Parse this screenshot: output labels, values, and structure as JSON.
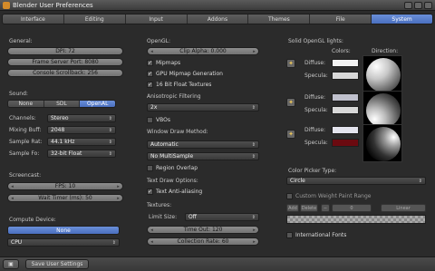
{
  "window": {
    "title": "Blender User Preferences"
  },
  "tabs": [
    {
      "label": "Interface",
      "active": false
    },
    {
      "label": "Editing",
      "active": false
    },
    {
      "label": "Input",
      "active": false
    },
    {
      "label": "Addons",
      "active": false
    },
    {
      "label": "Themes",
      "active": false
    },
    {
      "label": "File",
      "active": false
    },
    {
      "label": "System",
      "active": true
    }
  ],
  "general": {
    "heading": "General:",
    "dpi": "DPI: 72",
    "frame_server_port": "Frame Server Port: 8080",
    "console_scrollback": "Console Scrollback: 256"
  },
  "sound": {
    "heading": "Sound:",
    "options": [
      "None",
      "SDL",
      "OpenAL"
    ],
    "selected": "OpenAL",
    "channels_label": "Channels:",
    "channels_value": "Stereo",
    "mixing_label": "Mixing Buff:",
    "mixing_value": "2048",
    "sample_rate_label": "Sample Rat:",
    "sample_rate_value": "44.1 kHz",
    "sample_format_label": "Sample Fo:",
    "sample_format_value": "32-bit Float"
  },
  "screencast": {
    "heading": "Screencast:",
    "fps": "FPS: 10",
    "wait_timer": "Wait Timer (ms): 50"
  },
  "compute": {
    "heading": "Compute Device:",
    "button": "None",
    "device": "CPU"
  },
  "opengl": {
    "heading": "OpenGL:",
    "clip_alpha": "Clip Alpha: 0.000",
    "mipmaps": "Mipmaps",
    "gpu_mipmap": "GPU Mipmap Generation",
    "float_textures": "16 Bit Float Textures",
    "anisotropic_heading": "Anisotropic Filtering",
    "anisotropic_value": "2x",
    "vbos": "VBOs",
    "window_draw_heading": "Window Draw Method:",
    "window_draw_value": "Automatic",
    "multisample_value": "No MultiSample",
    "region_overlap": "Region Overlap",
    "text_draw_heading": "Text Draw Options:",
    "text_antialiasing": "Text Anti-aliasing",
    "textures_heading": "Textures:",
    "limit_size_label": "Limit Size:",
    "limit_size_value": "Off",
    "time_out": "Time Out: 120",
    "collection_rate": "Collection Rate: 60"
  },
  "solid_lights": {
    "heading": "Solid OpenGL lights:",
    "colors_label": "Colors:",
    "direction_label": "Direction:",
    "diffuse_label": "Diffuse:",
    "specular_label": "Specula:",
    "lights": [
      {
        "diffuse_color": "#f2f2f2",
        "specular_color": "#d8d8d8"
      },
      {
        "diffuse_color": "#bfc0cc",
        "specular_color": "#d8d8d8"
      },
      {
        "diffuse_color": "#e4e4ee",
        "specular_color": "#6b0a10"
      }
    ]
  },
  "color_picker": {
    "heading": "Color Picker Type:",
    "value": "Circle",
    "custom_weight": "Custom Weight Paint Range",
    "add_label": "Add",
    "delete_label": "Delete",
    "minus_label": "−",
    "zero_label": "0",
    "linear_label": "Linear",
    "international_fonts": "International Fonts"
  },
  "bottom": {
    "save_button": "Save User Settings"
  },
  "colors": {
    "accent": "#5a7fcf",
    "background": "#2b2b2b"
  }
}
